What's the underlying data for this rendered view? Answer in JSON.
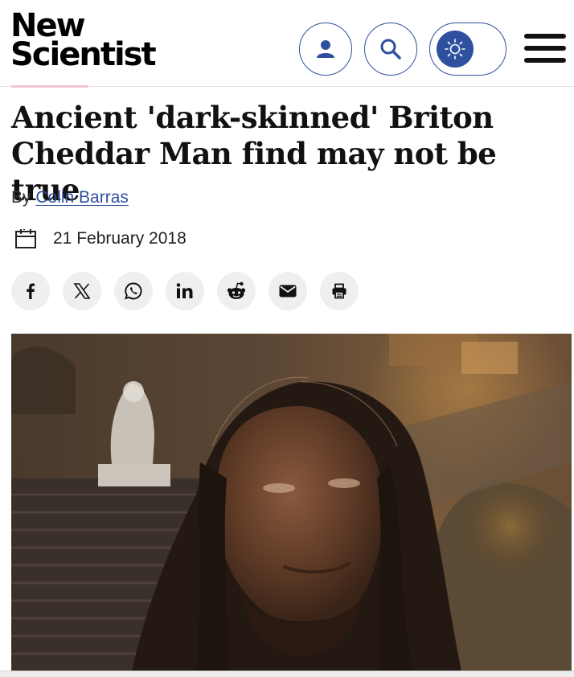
{
  "brand": {
    "line1": "New",
    "line2": "Scientist"
  },
  "header": {
    "account_icon": "person-icon",
    "search_icon": "search-icon",
    "theme_icon": "sun-icon",
    "menu_icon": "hamburger-menu-icon",
    "accent_color": "#2f4f9f"
  },
  "article": {
    "title": "Ancient 'dark-skinned' Briton Cheddar Man find may not be true",
    "byline_prefix": "By",
    "author": "Colin Barras",
    "date": "21 February 2018",
    "date_icon": "calendar-icon"
  },
  "share": [
    {
      "network": "facebook",
      "icon": "facebook-icon"
    },
    {
      "network": "x",
      "icon": "x-icon"
    },
    {
      "network": "whatsapp",
      "icon": "whatsapp-icon"
    },
    {
      "network": "linkedin",
      "icon": "linkedin-icon"
    },
    {
      "network": "reddit",
      "icon": "reddit-icon"
    },
    {
      "network": "email",
      "icon": "email-icon"
    },
    {
      "network": "print",
      "icon": "print-icon"
    }
  ]
}
